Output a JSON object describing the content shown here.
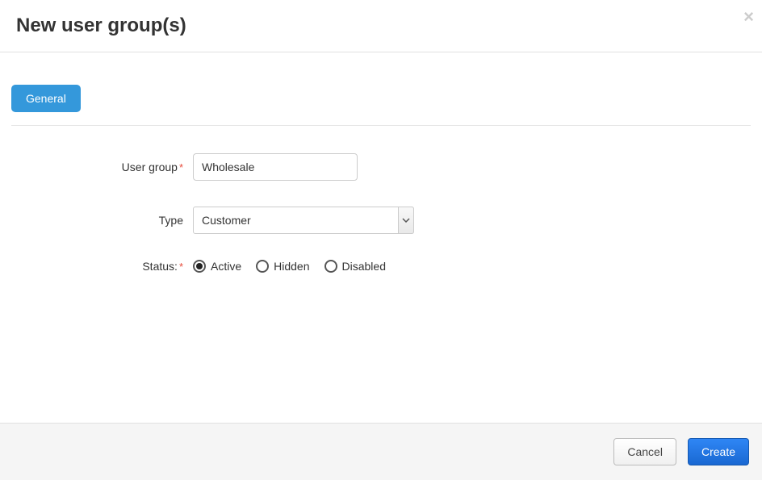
{
  "header": {
    "title": "New user group(s)"
  },
  "tabs": {
    "general": "General"
  },
  "form": {
    "user_group": {
      "label": "User group",
      "value": "Wholesale"
    },
    "type": {
      "label": "Type",
      "selected": "Customer"
    },
    "status": {
      "label": "Status:",
      "options": {
        "active": "Active",
        "hidden": "Hidden",
        "disabled": "Disabled"
      },
      "selected": "active"
    }
  },
  "footer": {
    "cancel": "Cancel",
    "create": "Create"
  }
}
